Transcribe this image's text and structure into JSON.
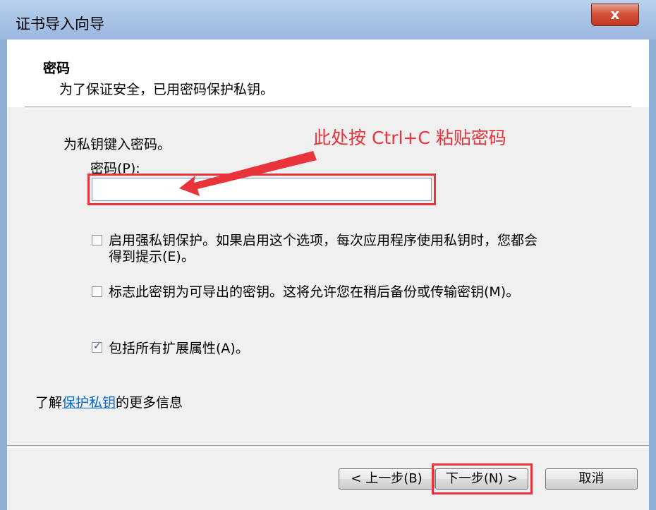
{
  "window": {
    "title": "证书导入向导",
    "close_label": "x"
  },
  "header": {
    "title": "密码",
    "subtitle": "为了保证安全，已用密码保护私钥。"
  },
  "body": {
    "prompt": "为私钥键入密码。",
    "password_label": "密码(P):",
    "password_value": "",
    "annotation": "此处按 Ctrl+C 粘贴密码",
    "options": [
      {
        "line1": "启用强私钥保护。如果启用这个选项，每次应用程序使用私钥时，您都会",
        "line2": "得到提示(E)。",
        "checked": false
      },
      {
        "line1": "标志此密钥为可导出的密钥。这将允许您在稍后备份或传输密钥(M)。",
        "checked": false
      },
      {
        "line1": "包括所有扩展属性(A)。",
        "checked": true
      }
    ],
    "info_prefix": "了解",
    "info_link": "保护私钥",
    "info_suffix": "的更多信息"
  },
  "buttons": {
    "back": "< 上一步(B)",
    "next": "下一步(N) >",
    "cancel": "取消"
  },
  "colors": {
    "annotation": "#e8343a",
    "link": "#0066cc"
  }
}
